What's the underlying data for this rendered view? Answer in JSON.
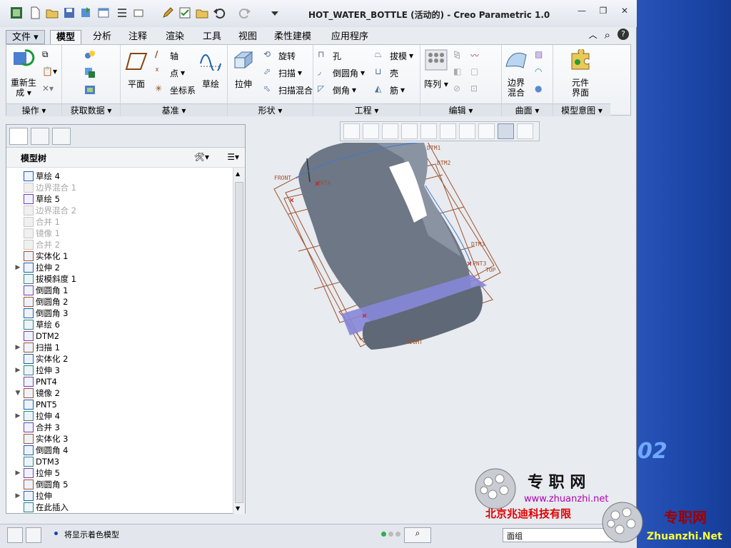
{
  "window": {
    "title": "HOT_WATER_BOTTLE (活动的) - Creo Parametric 1.0"
  },
  "tabs": [
    "文件",
    "模型",
    "分析",
    "注释",
    "渲染",
    "工具",
    "视图",
    "柔性建模",
    "应用程序"
  ],
  "ribbon": {
    "groups": {
      "operations": "操作",
      "get_data": "获取数据",
      "datum": "基准",
      "shapes": "形状",
      "engineering": "工程",
      "editing": "编辑",
      "surfaces": "曲面",
      "model_intent": "模型意图"
    },
    "regenerate_l1": "重新生",
    "regenerate_l2": "成",
    "plane": "平面",
    "axis": "轴",
    "point": "点",
    "csys": "坐标系",
    "sketch": "草绘",
    "extrude": "拉伸",
    "revolve": "旋转",
    "sweep": "扫描",
    "swept_blend": "扫描混合",
    "hole": "孔",
    "round": "倒圆角",
    "chamfer": "倒角",
    "draft": "拔模",
    "shell": "壳",
    "rib": "筋",
    "pattern": "阵列",
    "boundary_l1": "边界",
    "boundary_l2": "混合",
    "component_l1": "元件",
    "component_l2": "界面"
  },
  "model_tree": {
    "title": "模型树",
    "items": [
      {
        "label": "草绘 4",
        "dim": false,
        "expand": ""
      },
      {
        "label": "边界混合 1",
        "dim": true,
        "expand": ""
      },
      {
        "label": "草绘 5",
        "dim": false,
        "expand": ""
      },
      {
        "label": "边界混合 2",
        "dim": true,
        "expand": ""
      },
      {
        "label": "合并 1",
        "dim": true,
        "expand": ""
      },
      {
        "label": "镜像 1",
        "dim": true,
        "expand": ""
      },
      {
        "label": "合并 2",
        "dim": true,
        "expand": ""
      },
      {
        "label": "实体化 1",
        "dim": false,
        "expand": ""
      },
      {
        "label": "拉伸 2",
        "dim": false,
        "expand": "▶"
      },
      {
        "label": "拔模斜度 1",
        "dim": false,
        "expand": ""
      },
      {
        "label": "倒圆角 1",
        "dim": false,
        "expand": ""
      },
      {
        "label": "倒圆角 2",
        "dim": false,
        "expand": ""
      },
      {
        "label": "倒圆角 3",
        "dim": false,
        "expand": ""
      },
      {
        "label": "草绘 6",
        "dim": false,
        "expand": ""
      },
      {
        "label": "DTM2",
        "dim": false,
        "expand": ""
      },
      {
        "label": "扫描 1",
        "dim": false,
        "expand": "▶"
      },
      {
        "label": "实体化 2",
        "dim": false,
        "expand": ""
      },
      {
        "label": "拉伸 3",
        "dim": false,
        "expand": "▶"
      },
      {
        "label": "PNT4",
        "dim": false,
        "expand": ""
      },
      {
        "label": "镜像 2",
        "dim": false,
        "expand": "▼"
      },
      {
        "label": "PNT5",
        "dim": false,
        "expand": ""
      },
      {
        "label": "拉伸 4",
        "dim": false,
        "expand": "▶"
      },
      {
        "label": "合并 3",
        "dim": false,
        "expand": ""
      },
      {
        "label": "实体化 3",
        "dim": false,
        "expand": ""
      },
      {
        "label": "倒圆角 4",
        "dim": false,
        "expand": ""
      },
      {
        "label": "DTM3",
        "dim": false,
        "expand": ""
      },
      {
        "label": "拉伸 5",
        "dim": false,
        "expand": "▶"
      },
      {
        "label": "倒圆角 5",
        "dim": false,
        "expand": ""
      },
      {
        "label": "拉伸",
        "dim": false,
        "expand": "▶"
      },
      {
        "label": "在此插入",
        "dim": false,
        "expand": ""
      }
    ]
  },
  "graphics": {
    "labels": {
      "front": "FRONT",
      "dtm1": "DTM1",
      "dtm2": "DTM2",
      "dtm3": "DTM3",
      "pnt4": "PNT4",
      "pnt3": "PNT3",
      "top": "TOP",
      "right": "RIGHT"
    }
  },
  "status": {
    "message": "将显示着色模型",
    "filter_value": "面组"
  },
  "watermark": {
    "brand": "专 职 网",
    "url": "www.zhuanzhi.net",
    "company": "北京兆迪科技有限",
    "brand2": "专职网",
    "site2": "Zhuanzhi.Net",
    "version_tail": "02"
  },
  "colors": {
    "accent": "#1d3f8f",
    "datum": "#a0522d",
    "model": "#6d7786",
    "plane_fill": "#8686d8"
  }
}
